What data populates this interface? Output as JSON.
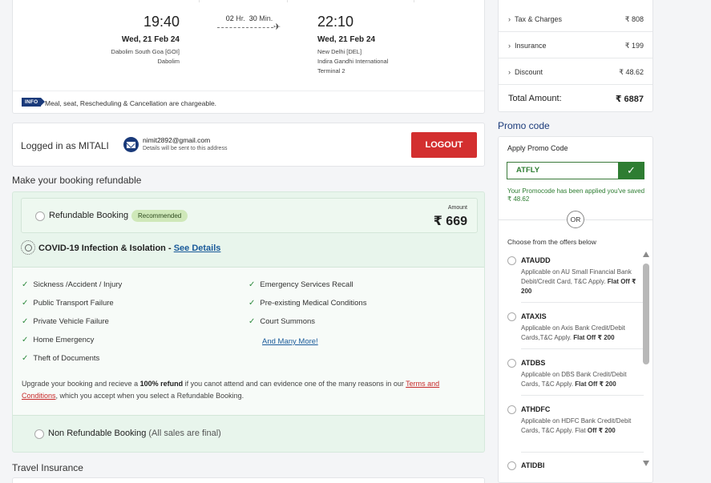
{
  "flight": {
    "departure": {
      "time": "19:40",
      "date": "Wed, 21 Feb 24",
      "airport_line": "Dabolim South Goa",
      "airport_code": "[GOI]",
      "city": "Dabolim"
    },
    "duration": {
      "hours": "02",
      "hr_label": "Hr.",
      "minutes": "30",
      "min_label": "Min."
    },
    "arrival": {
      "time": "22:10",
      "date": "Wed, 21 Feb 24",
      "airport_line": "New Delhi",
      "airport_code": "[DEL]",
      "name": "Indira Gandhi International",
      "terminal": "Terminal 2"
    },
    "info_badge": "INFO",
    "info_text": "Meal, seat, Rescheduling & Cancellation are chargeable."
  },
  "login": {
    "text": "Logged in as MITALI",
    "email": "nimit2892@gmail.com",
    "email_note": "Details will be sent to this address",
    "logout_label": "LOGOUT"
  },
  "refund_section": {
    "title": "Make your booking refundable",
    "option_label": "Refundable Booking",
    "recommended": "Recommended",
    "amount_label": "Amount",
    "amount_value": "₹ 669",
    "covid_text": "COVID-19 Infection & Isolation - ",
    "see_details": "See Details",
    "benefits_left": [
      "Sickness /Accident / Injury",
      "Public Transport Failure",
      "Private Vehicle Failure",
      "Home Emergency",
      "Theft of Documents"
    ],
    "benefits_right": [
      "Emergency Services Recall",
      "Pre-existing Medical Conditions",
      "Court Summons"
    ],
    "more_link": "And Many More!",
    "upgrade_pre": "Upgrade your booking and recieve a ",
    "upgrade_bold": "100% refund",
    "upgrade_mid": " if you canot attend and can evidence one of the many reasons in our ",
    "upgrade_link": "Terms and Conditions",
    "upgrade_post": ", which you accept when you select a Refundable Booking.",
    "non_refund_label": "Non Refundable Booking",
    "non_refund_note": " (All sales are final)"
  },
  "travel_insurance": {
    "title": "Travel Insurance"
  },
  "fare": {
    "rows": [
      {
        "label": "Tax & Charges",
        "value": "₹ 808"
      },
      {
        "label": "Insurance",
        "value": "₹ 199"
      },
      {
        "label": "Discount",
        "value": "₹ 48.62"
      }
    ],
    "total_label": "Total Amount:",
    "total_value": "₹ 6887"
  },
  "promo": {
    "section_title": "Promo code",
    "apply_label": "Apply Promo Code",
    "code_value": "ATFLY",
    "success_msg": "Your Promocode has been applied you've saved ₹ 48.62",
    "or_label": "OR",
    "offers_title": "Choose from the offers below",
    "offers": [
      {
        "code": "ATAUDD",
        "desc": "Applicable on AU Small Financial Bank Debit/Credit Card, T&C Apply. ",
        "flat": "Flat Off ₹ 200"
      },
      {
        "code": "ATAXIS",
        "desc": "Applicable on Axis Bank Credit/Debit Cards,T&C Apply. ",
        "flat": "Flat Off ₹ 200"
      },
      {
        "code": "ATDBS",
        "desc": "Applicable on DBS Bank Credit/Debit Cards, T&C Apply. ",
        "flat": "Flat Off ₹ 200"
      },
      {
        "code": "ATHDFC",
        "desc": "Applicable on HDFC Bank Credit/Debit Cards, T&C Apply. Flat ",
        "flat": "Off ₹ 200"
      },
      {
        "code": "ATIDBI",
        "desc": "",
        "flat": ""
      }
    ]
  },
  "colors": {
    "primary": "#1a3a7a",
    "logout": "#d32f2f",
    "success": "#2e7d32",
    "refund_bg": "#e8f5ec"
  },
  "icons": [
    "plane-icon",
    "mail-icon",
    "check-icon",
    "virus-icon",
    "chevron-right-icon"
  ]
}
